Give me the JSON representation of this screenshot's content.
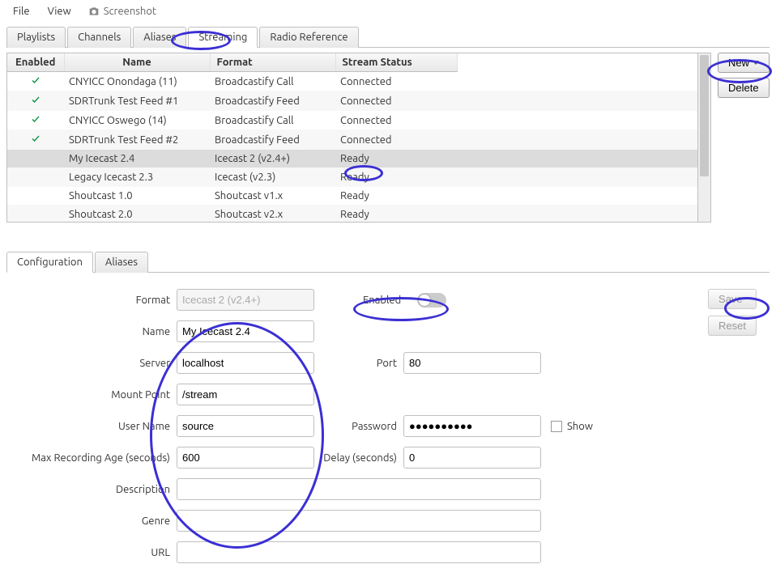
{
  "menu": {
    "file": "File",
    "view": "View",
    "screenshot": "Screenshot"
  },
  "tabs": [
    "Playlists",
    "Channels",
    "Aliases",
    "Streaming",
    "Radio Reference"
  ],
  "activeTab": 3,
  "table": {
    "headers": [
      "Enabled",
      "Name",
      "Format",
      "Stream Status"
    ],
    "rows": [
      {
        "enabled": true,
        "name": "CNYICC Onondaga (11)",
        "format": "Broadcastify Call",
        "status": "Connected",
        "selected": false
      },
      {
        "enabled": true,
        "name": "SDRTrunk Test Feed #1",
        "format": "Broadcastify Feed",
        "status": "Connected",
        "selected": false
      },
      {
        "enabled": true,
        "name": "CNYICC Oswego (14)",
        "format": "Broadcastify Call",
        "status": "Connected",
        "selected": false
      },
      {
        "enabled": true,
        "name": "SDRTrunk Test Feed #2",
        "format": "Broadcastify Feed",
        "status": "Connected",
        "selected": false
      },
      {
        "enabled": false,
        "name": "My Icecast 2.4",
        "format": "Icecast 2 (v2.4+)",
        "status": "Ready",
        "selected": true
      },
      {
        "enabled": false,
        "name": "Legacy Icecast 2.3",
        "format": "Icecast (v2.3)",
        "status": "Ready",
        "selected": false
      },
      {
        "enabled": false,
        "name": "Shoutcast 1.0",
        "format": "Shoutcast v1.x",
        "status": "Ready",
        "selected": false
      },
      {
        "enabled": false,
        "name": "Shoutcast 2.0",
        "format": "Shoutcast v2.x",
        "status": "Ready",
        "selected": false
      }
    ]
  },
  "sideButtons": {
    "new": "New",
    "delete": "Delete"
  },
  "subTabs": [
    "Configuration",
    "Aliases"
  ],
  "activeSubTab": 0,
  "form": {
    "labels": {
      "format": "Format",
      "enabled": "Enabled",
      "name": "Name",
      "server": "Server",
      "port": "Port",
      "mount": "Mount Point",
      "user": "User Name",
      "password": "Password",
      "show": "Show",
      "maxage": "Max Recording Age (seconds)",
      "delay": "Delay (seconds)",
      "desc": "Description",
      "genre": "Genre",
      "url": "URL"
    },
    "values": {
      "format": "Icecast 2 (v2.4+)",
      "name": "My Icecast 2.4",
      "server": "localhost",
      "port": "80",
      "mount": "/stream",
      "user": "source",
      "password": "●●●●●●●●●●",
      "maxage": "600",
      "delay": "0",
      "desc": "",
      "genre": "",
      "url": ""
    },
    "save": "Save",
    "reset": "Reset"
  }
}
